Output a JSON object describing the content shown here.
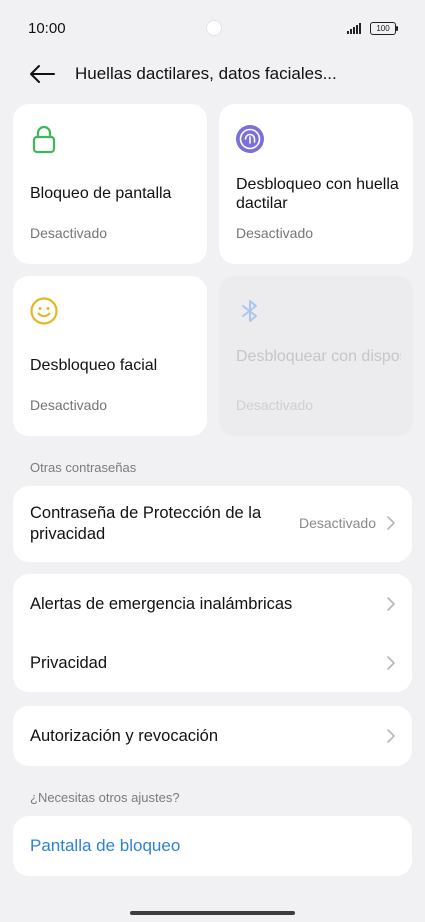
{
  "status_bar": {
    "time": "10:00",
    "battery": "100"
  },
  "header": {
    "title": "Huellas dactilares, datos faciales..."
  },
  "tiles": [
    {
      "title": "Bloqueo de pantalla",
      "status": "Desactivado",
      "icon": "lock-icon",
      "color": "#3cb85b"
    },
    {
      "title": "Desbloqueo con huella dactilar",
      "status": "Desactivado",
      "icon": "fingerprint-icon",
      "color": "#7b6fd9"
    },
    {
      "title": "Desbloqueo facial",
      "status": "Desactivado",
      "icon": "face-icon",
      "color": "#e6b626"
    },
    {
      "title": "Desbloquear con dispositivo Bl...",
      "status": "Desactivado",
      "icon": "bluetooth-icon",
      "color": "#a9c6ef",
      "disabled": true
    }
  ],
  "sections": {
    "other_passwords": "Otras contraseñas",
    "need_other": "¿Necesitas otros ajustes?"
  },
  "rows": {
    "privacy_password": {
      "label": "Contraseña de Protección de la privacidad",
      "value": "Desactivado"
    },
    "emergency_alerts": {
      "label": "Alertas de emergencia inalámbricas"
    },
    "privacy": {
      "label": "Privacidad"
    },
    "authorization": {
      "label": "Autorización y revocación"
    },
    "lock_screen": {
      "label": "Pantalla de bloqueo"
    }
  },
  "colors": {
    "background": "#f1f1f3",
    "card": "#ffffff",
    "link": "#2e82d6"
  }
}
